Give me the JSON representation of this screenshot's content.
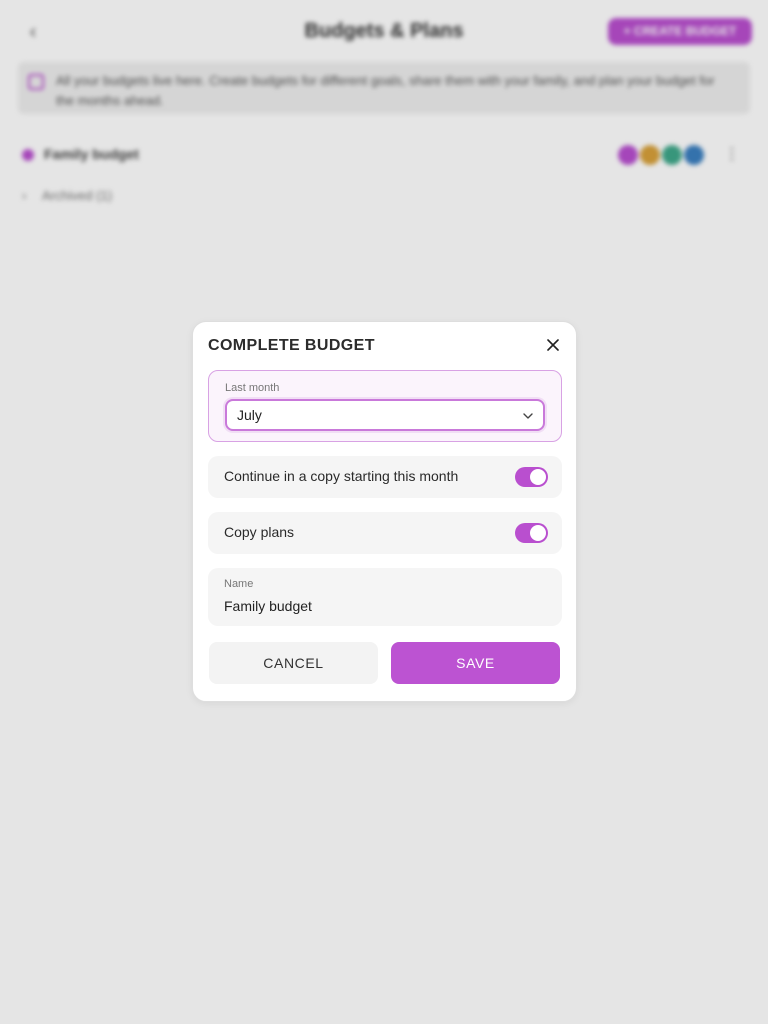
{
  "background": {
    "header": {
      "title": "Budgets & Plans",
      "create_button_label": "+ CREATE BUDGET"
    },
    "info_text": "All your budgets live here. Create budgets for different goals, share them with your family, and plan your budget for the months ahead.",
    "budget": {
      "name": "Family budget",
      "color": "#b94fcf",
      "avatar_colors": [
        "#b84fd0",
        "#d8a13a",
        "#3fa88a",
        "#3a7fc0"
      ]
    },
    "archived_label": "Archived (1)"
  },
  "dialog": {
    "title": "COMPLETE BUDGET",
    "last_month": {
      "label": "Last month",
      "value": "July"
    },
    "toggles": [
      {
        "label": "Continue in a copy starting this month",
        "on": true
      },
      {
        "label": "Copy plans",
        "on": true
      }
    ],
    "name": {
      "label": "Name",
      "value": "Family budget"
    },
    "cancel_label": "CANCEL",
    "save_label": "SAVE"
  },
  "colors": {
    "accent": "#bc53d2",
    "accent_light": "#fbf4fc",
    "field_bg": "#f5f5f5"
  }
}
